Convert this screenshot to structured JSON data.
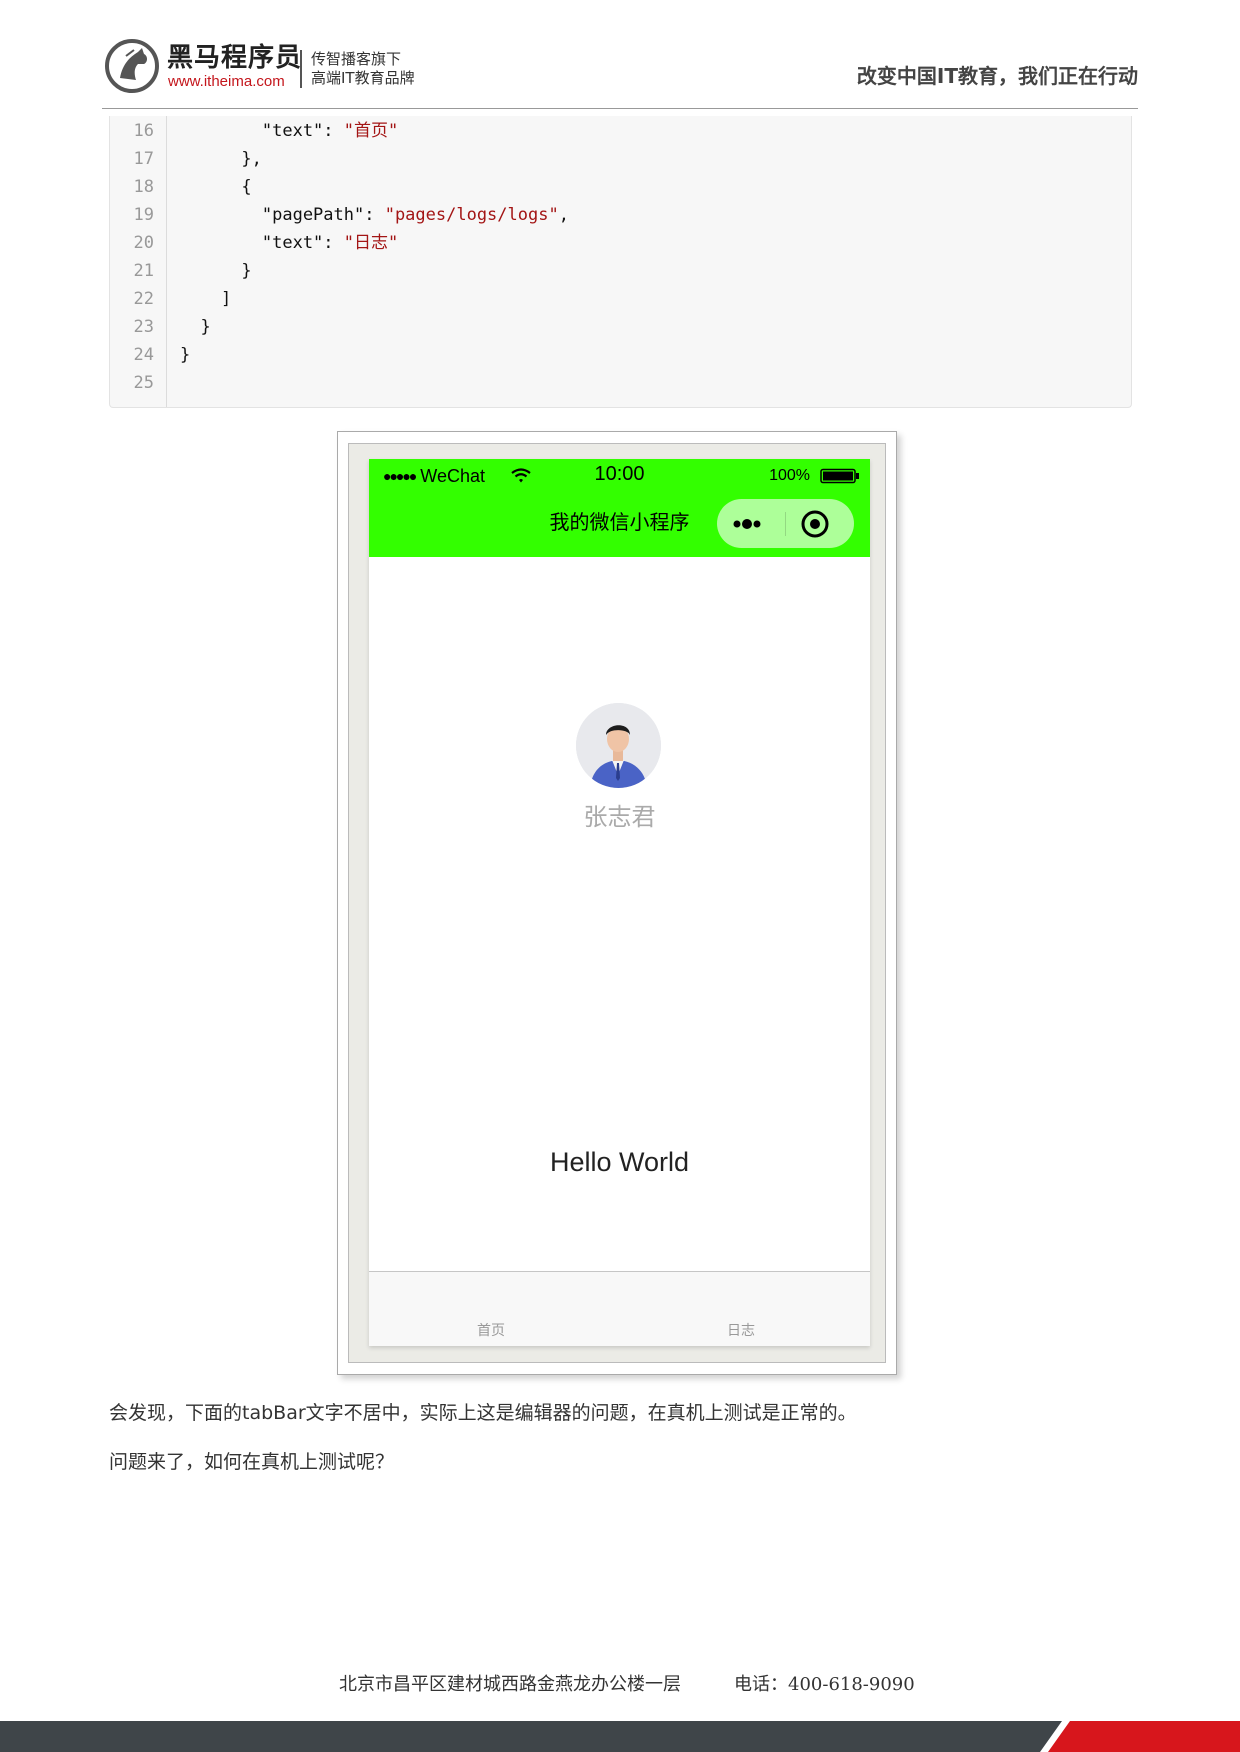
{
  "header": {
    "brand_name": "黑马程序员",
    "brand_url": "www.itheima.com",
    "tagline_line1": "传智播客旗下",
    "tagline_line2": "高端IT教育品牌",
    "slogan": "改变中国IT教育，我们正在行动"
  },
  "code": {
    "lines": [
      {
        "num": "16",
        "prefix": "        \"text\": ",
        "string": "\"首页\"",
        "suffix": ""
      },
      {
        "num": "17",
        "prefix": "      },",
        "string": "",
        "suffix": ""
      },
      {
        "num": "18",
        "prefix": "      {",
        "string": "",
        "suffix": ""
      },
      {
        "num": "19",
        "prefix": "        \"pagePath\": ",
        "string": "\"pages/logs/logs\"",
        "suffix": ","
      },
      {
        "num": "20",
        "prefix": "        \"text\": ",
        "string": "\"日志\"",
        "suffix": ""
      },
      {
        "num": "21",
        "prefix": "      }",
        "string": "",
        "suffix": ""
      },
      {
        "num": "22",
        "prefix": "    ]",
        "string": "",
        "suffix": ""
      },
      {
        "num": "23",
        "prefix": "  }",
        "string": "",
        "suffix": ""
      },
      {
        "num": "24",
        "prefix": "}",
        "string": "",
        "suffix": ""
      },
      {
        "num": "25",
        "prefix": "",
        "string": "",
        "suffix": ""
      }
    ]
  },
  "phone": {
    "status_bar": {
      "signal_dots": "●●●●●",
      "carrier": "WeChat",
      "time": "10:00",
      "battery": "100%"
    },
    "nav_title": "我的微信小程序",
    "nav_bg_color": "#33ff00",
    "nickname": "张志君",
    "hello": "Hello World",
    "tabs": [
      "首页",
      "日志"
    ]
  },
  "body": {
    "para1": "会发现，下面的tabBar文字不居中，实际上这是编辑器的问题，在真机上测试是正常的。",
    "para2": "问题来了，如何在真机上测试呢？"
  },
  "footer": {
    "address": "北京市昌平区建材城西路金燕龙办公楼一层",
    "phone": "电话：400-618-9090"
  }
}
